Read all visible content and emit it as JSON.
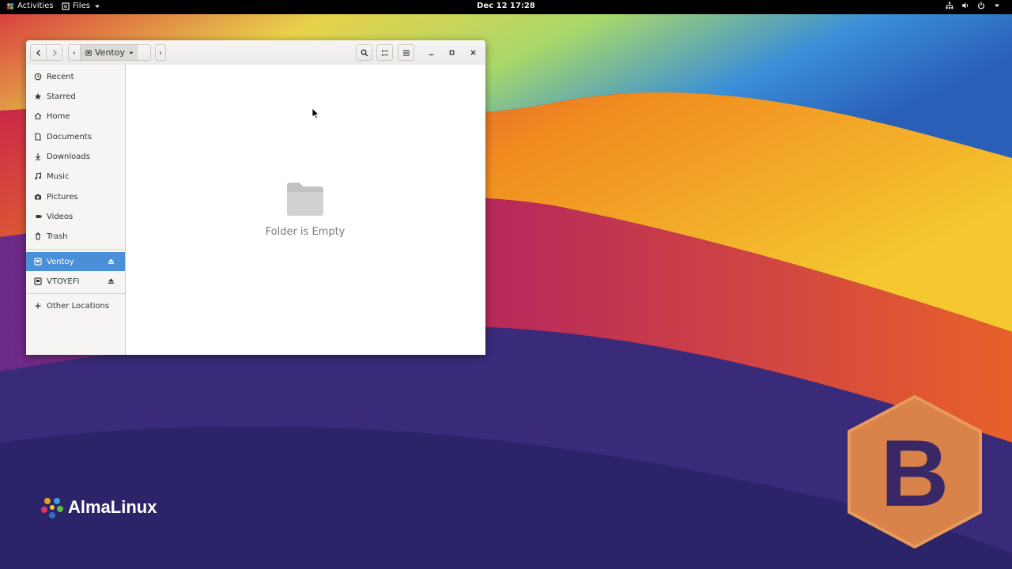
{
  "topbar": {
    "activities": "Activities",
    "app_menu": "Files",
    "clock": "Dec 12  17:28",
    "tray_icons": [
      "network-icon",
      "volume-icon",
      "power-icon"
    ]
  },
  "window": {
    "location": "Ventoy",
    "sidebar": {
      "places": [
        {
          "label": "Recent",
          "icon": "clock-icon"
        },
        {
          "label": "Starred",
          "icon": "star-icon"
        },
        {
          "label": "Home",
          "icon": "home-icon"
        },
        {
          "label": "Documents",
          "icon": "document-icon"
        },
        {
          "label": "Downloads",
          "icon": "download-icon"
        },
        {
          "label": "Music",
          "icon": "music-icon"
        },
        {
          "label": "Pictures",
          "icon": "camera-icon"
        },
        {
          "label": "Videos",
          "icon": "video-icon"
        },
        {
          "label": "Trash",
          "icon": "trash-icon"
        }
      ],
      "devices": [
        {
          "label": "Ventoy",
          "icon": "drive-icon",
          "selected": true
        },
        {
          "label": "VTOYEFI",
          "icon": "drive-icon",
          "selected": false
        }
      ],
      "other": {
        "label": "Other Locations",
        "icon": "plus-icon"
      }
    },
    "content": {
      "empty_message": "Folder is Empty"
    }
  },
  "branding": {
    "distro": "AlmaLinux",
    "badge_letter": "B"
  },
  "colors": {
    "selection": "#4a90d9",
    "topbar": "#000000"
  }
}
